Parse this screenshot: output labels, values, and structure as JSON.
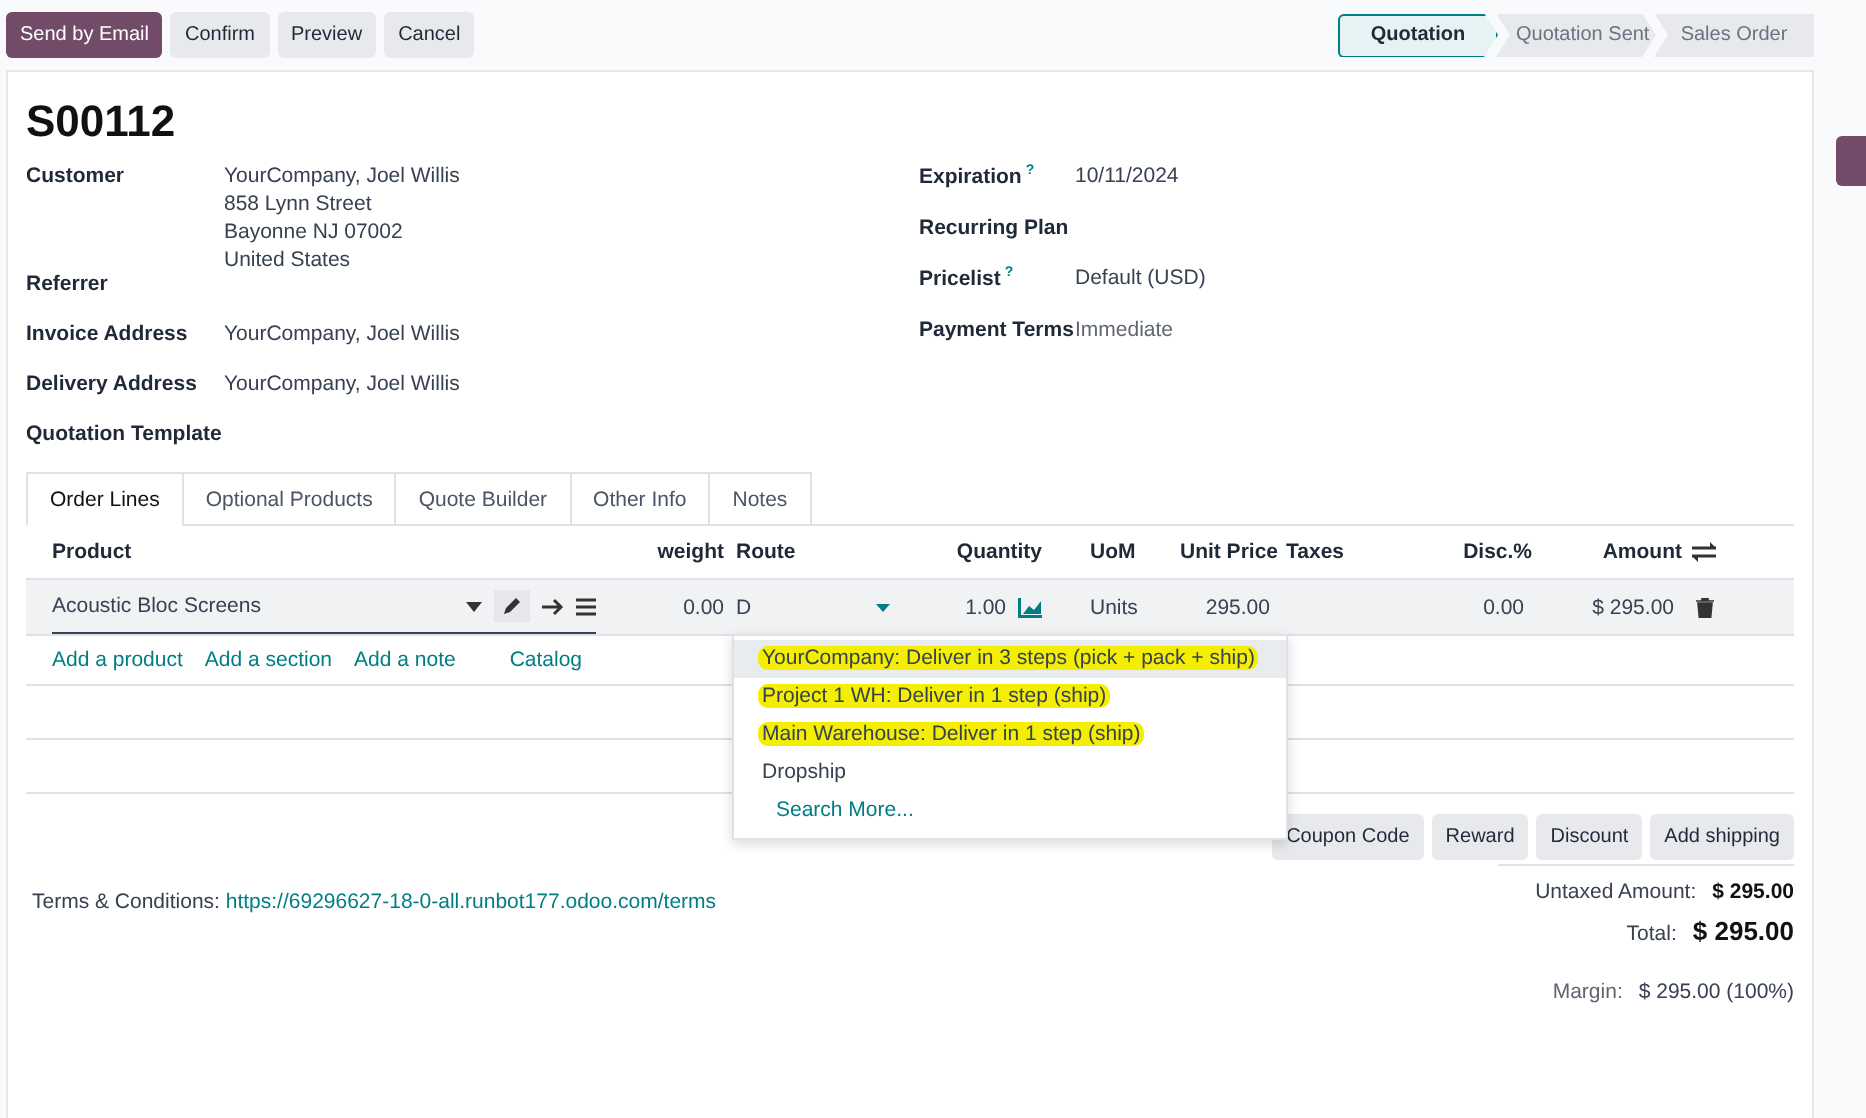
{
  "actions": [
    {
      "label": "Send by Email",
      "kind": "primary"
    },
    {
      "label": "Confirm",
      "kind": "secondary"
    },
    {
      "label": "Preview",
      "kind": "secondary"
    },
    {
      "label": "Cancel",
      "kind": "secondary"
    }
  ],
  "status_steps": [
    {
      "label": "Quotation",
      "selected": true
    },
    {
      "label": "Quotation Sent",
      "selected": false
    },
    {
      "label": "Sales Order",
      "selected": false
    }
  ],
  "title": "S00112",
  "left_fields": [
    {
      "label": "Customer",
      "lines": [
        "YourCompany, Joel Willis",
        "858 Lynn Street",
        "Bayonne NJ 07002",
        "United States"
      ]
    },
    {
      "label": "Referrer"
    },
    {
      "label": "Invoice Address",
      "lines": [
        "YourCompany, Joel Willis"
      ]
    },
    {
      "label": "Delivery Address",
      "lines": [
        "YourCompany, Joel Willis"
      ]
    },
    {
      "label": "Quotation Template"
    }
  ],
  "right_fields": [
    {
      "label": "Expiration",
      "help": "?",
      "value": "10/11/2024",
      "muted": false
    },
    {
      "label": "Recurring Plan"
    },
    {
      "label": "Pricelist",
      "help": "?",
      "value": "Default (USD)",
      "muted": false
    },
    {
      "label": "Payment Terms",
      "value": "Immediate",
      "muted": true
    }
  ],
  "tabs": [
    {
      "label": "Order Lines",
      "selected": true
    },
    {
      "label": "Optional Products",
      "selected": false
    },
    {
      "label": "Quote Builder",
      "selected": false
    },
    {
      "label": "Other Info",
      "selected": false
    },
    {
      "label": "Notes",
      "selected": false
    }
  ],
  "columns": [
    "Product",
    "weight",
    "Route",
    "Quantity",
    "UoM",
    "Unit Price",
    "Taxes",
    "Disc.%",
    "Amount"
  ],
  "line": {
    "product": "Acoustic Bloc Screens",
    "weight": "0.00",
    "route": "D",
    "quantity": "1.00",
    "uom": "Units",
    "unit_price": "295.00",
    "discount": "0.00",
    "amount": "$ 295.00"
  },
  "add_links": [
    "Add a product",
    "Add a section",
    "Add a note",
    "Catalog"
  ],
  "route_options": [
    {
      "label": "YourCompany: Deliver in 3 steps (pick + pack + ship)",
      "selected": true,
      "highlighted": true
    },
    {
      "label": "Project 1 WH: Deliver in 1 step (ship)",
      "selected": false,
      "highlighted": true
    },
    {
      "label": "Main Warehouse: Deliver in 1 step (ship)",
      "selected": false,
      "highlighted": true
    },
    {
      "label": "Dropship",
      "selected": false,
      "highlighted": false
    }
  ],
  "search_more": "Search More...",
  "line_buttons": [
    "Coupon Code",
    "Reward",
    "Discount",
    "Add shipping"
  ],
  "terms": {
    "label": "Terms & Conditions:",
    "link": "https://69296627-18-0-all.runbot177.odoo.com/terms"
  },
  "totals": {
    "untaxed_label": "Untaxed Amount:",
    "untaxed": "$ 295.00",
    "total_label": "Total:",
    "total": "$ 295.00",
    "margin_label": "Margin:",
    "margin": "$ 295.00 (100%)"
  }
}
